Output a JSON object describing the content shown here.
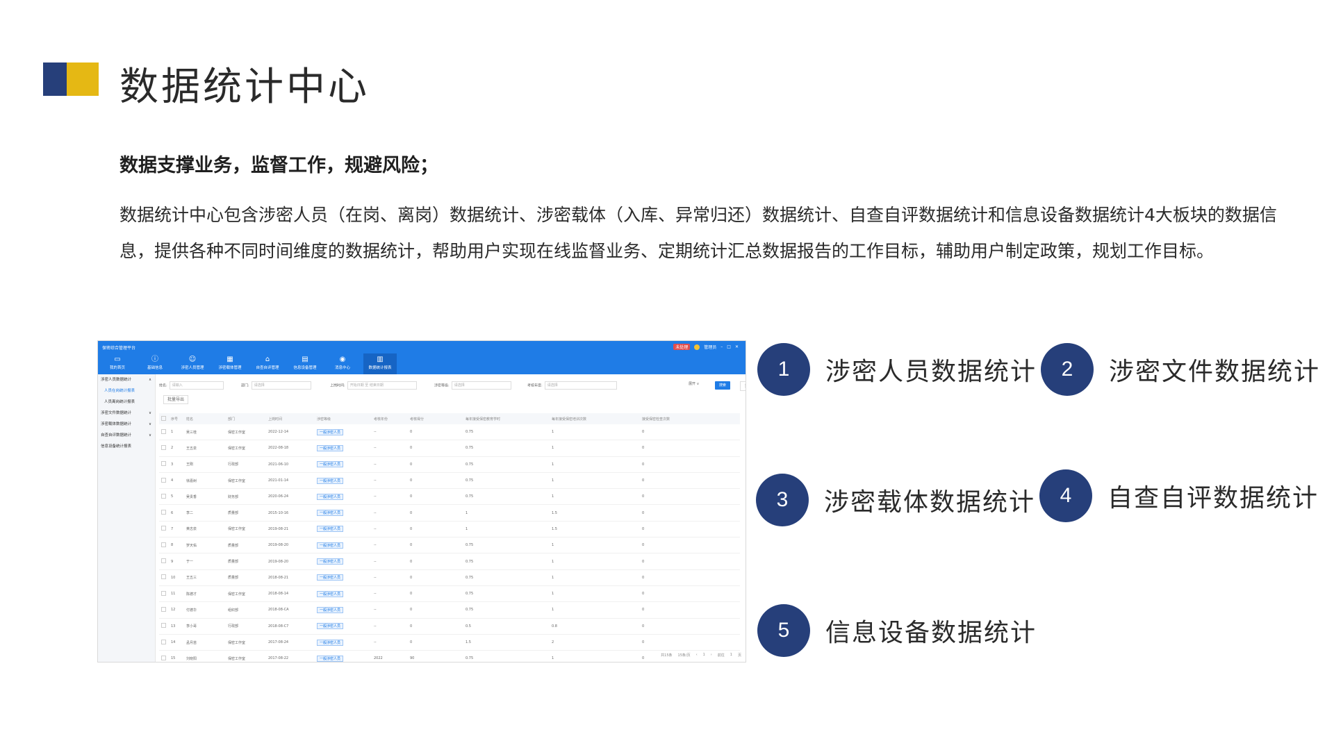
{
  "slide": {
    "title": "数据统计中心",
    "subheading": "数据支撑业务，监督工作，规避风险；",
    "description": "数据统计中心包含涉密人员（在岗、离岗）数据统计、涉密载体（入库、异常归还）数据统计、自查自评数据统计和信息设备数据统计4大板块的数据信息，提供各种不同时间维度的数据统计，帮助用户实现在线监督业务、定期统计汇总数据报告的工作目标，辅助用户制定政策，规划工作目标。",
    "brand_colors": {
      "navy": "#263f7a",
      "yellow": "#e5b814"
    }
  },
  "features": [
    {
      "number": "1",
      "label": "涉密人员数据统计"
    },
    {
      "number": "2",
      "label": "涉密文件数据统计"
    },
    {
      "number": "3",
      "label": "涉密载体数据统计"
    },
    {
      "number": "4",
      "label": "自查自评数据统计"
    },
    {
      "number": "5",
      "label": "信息设备数据统计"
    }
  ],
  "app": {
    "accent_color": "#1f7ce6",
    "logo": "保密综合管理平台",
    "status": {
      "tag": "未处理",
      "user": "管理员"
    },
    "nav": [
      {
        "icon": "monitor-icon",
        "label": "我的首页"
      },
      {
        "icon": "info-icon",
        "label": "基础信息"
      },
      {
        "icon": "user-icon",
        "label": "涉密人员管理"
      },
      {
        "icon": "calendar-icon",
        "label": "涉密载体管理"
      },
      {
        "icon": "home-icon",
        "label": "自查自评管理"
      },
      {
        "icon": "device-icon",
        "label": "信息设备管理"
      },
      {
        "icon": "chat-icon",
        "label": "消息中心"
      },
      {
        "icon": "chart-icon",
        "label": "数据统计报表"
      }
    ],
    "sidebar": [
      {
        "label": "涉密人员数据统计",
        "caret": "∧"
      },
      {
        "label": "人员在岗统计报表",
        "caret": ""
      },
      {
        "label": "人员离岗统计报表",
        "caret": ""
      },
      {
        "label": "涉密文件数据统计",
        "caret": "∨"
      },
      {
        "label": "涉密载体数据统计",
        "caret": "∨"
      },
      {
        "label": "自查自评数据统计",
        "caret": "∨"
      },
      {
        "label": "信息设备统计报表",
        "caret": ""
      }
    ],
    "filters": {
      "name_label": "姓名:",
      "name_placeholder": "请输入",
      "dept_label": "部门:",
      "dept_placeholder": "请选择",
      "date_label": "上岗时间:",
      "date_start": "开始日期",
      "date_sep": "至",
      "date_end": "结束日期",
      "level_label": "涉密等级:",
      "level_placeholder": "请选择",
      "year_label": "考核年度:",
      "year_placeholder": "请选择",
      "expand_label": "展开 ∨",
      "query_label": "搜索",
      "reset_label": "重置",
      "export_label": "批量导出"
    },
    "table": {
      "headers": [
        "",
        "序号",
        "姓名",
        "部门",
        "上岗时间",
        "涉密等级",
        "考核年份",
        "考核得分",
        "每年接受保密教育学时",
        "每年接受保密培训次数",
        "接受保密检查次数"
      ],
      "rows": [
        [
          "1",
          "吴三桂",
          "保密工作室",
          "2022-12-14",
          "一般涉密人员",
          "--",
          "0",
          "0.75",
          "1",
          "0"
        ],
        [
          "2",
          "王五泉",
          "保密工作室",
          "2022-08-18",
          "一般涉密人员",
          "--",
          "0",
          "0.75",
          "1",
          "0"
        ],
        [
          "3",
          "王刚",
          "行政部",
          "2021-06-10",
          "一般涉密人员",
          "--",
          "0",
          "0.75",
          "1",
          "0"
        ],
        [
          "4",
          "徐嘉树",
          "保密工作室",
          "2021-01-14",
          "一般涉密人员",
          "--",
          "0",
          "0.75",
          "1",
          "0"
        ],
        [
          "5",
          "吴贵香",
          "财务部",
          "2020-06-24",
          "一般涉密人员",
          "--",
          "0",
          "0.75",
          "1",
          "0"
        ],
        [
          "6",
          "李二",
          "质量部",
          "2015-10-16",
          "一般涉密人员",
          "--",
          "0",
          "1",
          "1.5",
          "0"
        ],
        [
          "7",
          "黄志泉",
          "保密工作室",
          "2019-08-21",
          "一般涉密人员",
          "--",
          "0",
          "1",
          "1.5",
          "0"
        ],
        [
          "8",
          "罗天佑",
          "质量部",
          "2019-08-20",
          "一般涉密人员",
          "--",
          "0",
          "0.75",
          "1",
          "0"
        ],
        [
          "9",
          "于一",
          "质量部",
          "2019-08-20",
          "一般涉密人员",
          "--",
          "0",
          "0.75",
          "1",
          "0"
        ],
        [
          "10",
          "王五三",
          "质量部",
          "2018-08-21",
          "一般涉密人员",
          "--",
          "0",
          "0.75",
          "1",
          "0"
        ],
        [
          "11",
          "陈德才",
          "保密工作室",
          "2018-08-14",
          "一般涉密人员",
          "--",
          "0",
          "0.75",
          "1",
          "0"
        ],
        [
          "12",
          "付德华",
          "组织部",
          "2018-08-CA",
          "一般涉密人员",
          "--",
          "0",
          "0.75",
          "1",
          "0"
        ],
        [
          "13",
          "李小哥",
          "行政部",
          "2018-08-C7",
          "一般涉密人员",
          "--",
          "0",
          "0.5",
          "0.8",
          "0"
        ],
        [
          "14",
          "孟月苗",
          "保密工作室",
          "2017-08-24",
          "一般涉密人员",
          "--",
          "0",
          "1.5",
          "2",
          "0"
        ],
        [
          "15",
          "刘晓阳",
          "保密工作室",
          "2017-08-22",
          "一般涉密人员",
          "2022",
          "90",
          "0.75",
          "1",
          "0"
        ]
      ]
    },
    "pager": {
      "total": "共15条",
      "page_size": "15条/页",
      "prev": "‹",
      "current": "1",
      "next": "›",
      "goto_label": "前往",
      "goto_value": "1",
      "goto_suffix": "页"
    }
  }
}
